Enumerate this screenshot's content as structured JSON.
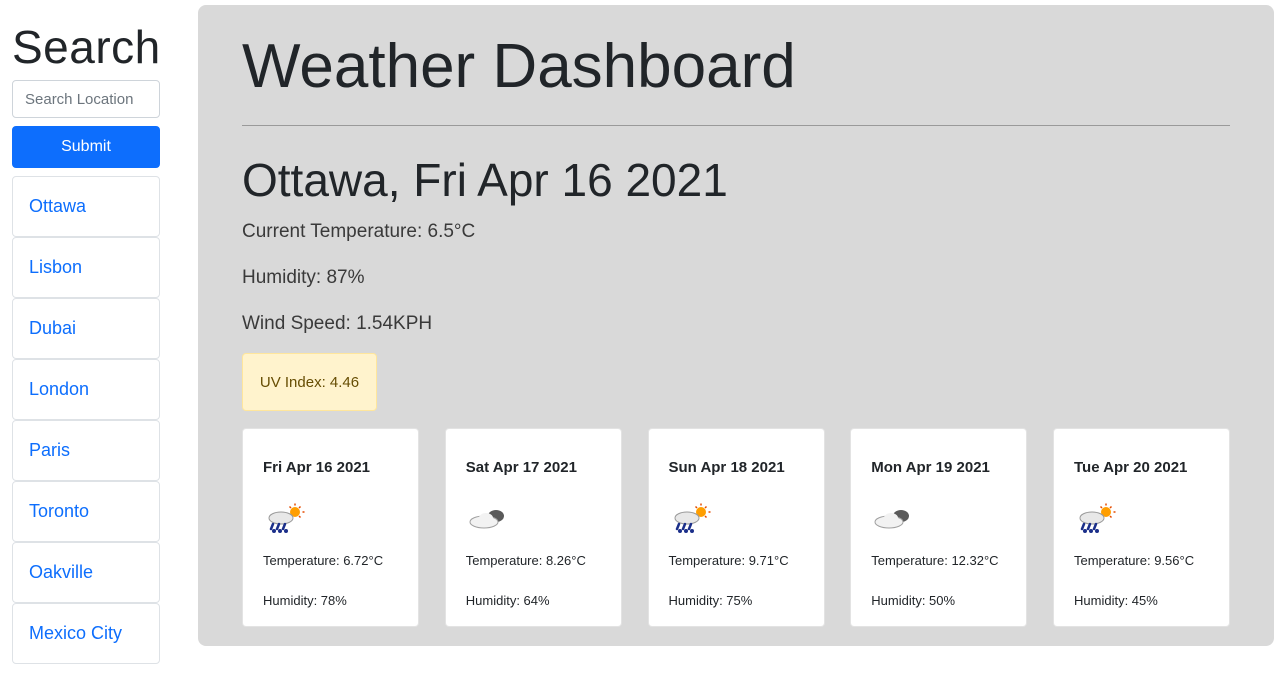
{
  "sidebar": {
    "title": "Search",
    "search_placeholder": "Search Location",
    "submit_label": "Submit",
    "cities": [
      "Ottawa",
      "Lisbon",
      "Dubai",
      "London",
      "Paris",
      "Toronto",
      "Oakville",
      "Mexico City"
    ]
  },
  "dashboard": {
    "title": "Weather Dashboard",
    "city_date": "Ottawa, Fri Apr 16 2021",
    "current_temperature": "Current Temperature: 6.5°C",
    "humidity": "Humidity: 87%",
    "wind_speed": "Wind Speed: 1.54KPH",
    "uv_index": "UV Index: 4.46",
    "uv_color": "#fff3cd"
  },
  "forecast": [
    {
      "date": "Fri Apr 16 2021",
      "icon": "rain-sun-icon",
      "temperature": "Temperature: 6.72°C",
      "humidity": "Humidity: 78%"
    },
    {
      "date": "Sat Apr 17 2021",
      "icon": "cloud-icon",
      "temperature": "Temperature: 8.26°C",
      "humidity": "Humidity: 64%"
    },
    {
      "date": "Sun Apr 18 2021",
      "icon": "rain-sun-icon",
      "temperature": "Temperature: 9.71°C",
      "humidity": "Humidity: 75%"
    },
    {
      "date": "Mon Apr 19 2021",
      "icon": "cloud-icon",
      "temperature": "Temperature: 12.32°C",
      "humidity": "Humidity: 50%"
    },
    {
      "date": "Tue Apr 20 2021",
      "icon": "rain-sun-icon",
      "temperature": "Temperature: 9.56°C",
      "humidity": "Humidity: 45%"
    }
  ],
  "colors": {
    "accent": "#0d6efd",
    "panel": "#d9d9d9"
  }
}
